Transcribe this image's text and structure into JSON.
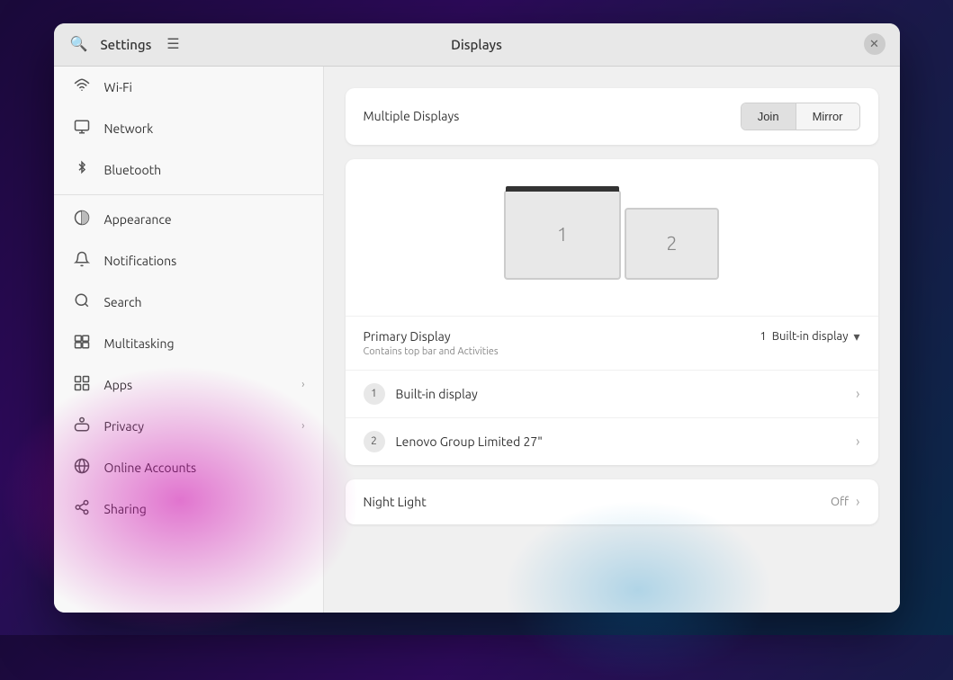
{
  "window": {
    "title": "Settings",
    "panel_title": "Displays"
  },
  "sidebar": {
    "items": [
      {
        "id": "wifi",
        "label": "Wi-Fi",
        "icon": "wifi",
        "has_chevron": false
      },
      {
        "id": "network",
        "label": "Network",
        "icon": "network",
        "has_chevron": false
      },
      {
        "id": "bluetooth",
        "label": "Bluetooth",
        "icon": "bluetooth",
        "has_chevron": false
      },
      {
        "id": "appearance",
        "label": "Appearance",
        "icon": "appearance",
        "has_chevron": false
      },
      {
        "id": "notifications",
        "label": "Notifications",
        "icon": "notifications",
        "has_chevron": false
      },
      {
        "id": "search",
        "label": "Search",
        "icon": "search",
        "has_chevron": false
      },
      {
        "id": "multitasking",
        "label": "Multitasking",
        "icon": "multitasking",
        "has_chevron": false
      },
      {
        "id": "apps",
        "label": "Apps",
        "icon": "apps",
        "has_chevron": true
      },
      {
        "id": "privacy",
        "label": "Privacy",
        "icon": "privacy",
        "has_chevron": true
      },
      {
        "id": "online-accounts",
        "label": "Online Accounts",
        "icon": "online-accounts",
        "has_chevron": false
      },
      {
        "id": "sharing",
        "label": "Sharing",
        "icon": "sharing",
        "has_chevron": false
      }
    ]
  },
  "multiple_displays": {
    "label": "Multiple Displays",
    "join_label": "Join",
    "mirror_label": "Mirror",
    "active": "join"
  },
  "displays": {
    "display1": {
      "number": "1"
    },
    "display2": {
      "number": "2"
    }
  },
  "primary_display": {
    "title": "Primary Display",
    "subtitle": "Contains top bar and Activities",
    "selected_number": "1",
    "selected_label": "Built-in display"
  },
  "display_list": [
    {
      "number": "1",
      "name": "Built-in display"
    },
    {
      "number": "2",
      "name": "Lenovo Group Limited 27\""
    }
  ],
  "night_light": {
    "label": "Night Light",
    "status": "Off"
  },
  "icons": {
    "chevron_right": "›",
    "dropdown_arrow": "▾",
    "search": "🔍",
    "menu": "☰",
    "close": "✕"
  }
}
